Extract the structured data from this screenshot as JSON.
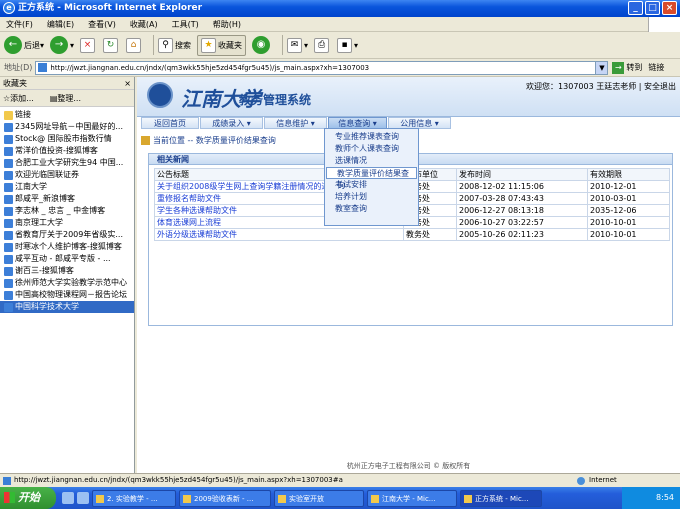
{
  "window": {
    "title": "正方系统 - Microsoft Internet Explorer"
  },
  "menu": [
    "文件(F)",
    "编辑(E)",
    "查看(V)",
    "收藏(A)",
    "工具(T)",
    "帮助(H)"
  ],
  "toolbar": {
    "back": "后退",
    "search": "搜索",
    "favorites": "收藏夹"
  },
  "address": {
    "label": "地址(D)",
    "url": "http://jwzt.jiangnan.edu.cn/jndx/(qm3wkk55hje5zd454fgr5u45)/js_main.aspx?xh=1307003",
    "go": "转到",
    "links": "链接"
  },
  "favorites": {
    "header": "收藏夹",
    "add": "添加...",
    "organize": "整理...",
    "items": [
      {
        "label": "链接",
        "folder": true
      },
      {
        "label": "2345网址导航－中国最好的..."
      },
      {
        "label": "Stock@ 国际股市指数行情"
      },
      {
        "label": "常洋价值投资-搜狐博客"
      },
      {
        "label": "合肥工业大学研究生94 中国..."
      },
      {
        "label": "欢迎光临国联证券"
      },
      {
        "label": "江南大学"
      },
      {
        "label": "郎咸平_新浪博客"
      },
      {
        "label": "李志林 _ 忠言 _ 中金博客"
      },
      {
        "label": "南京理工大学"
      },
      {
        "label": "省教育厅关于2009年省级实..."
      },
      {
        "label": "时寒冰个人维护博客-搜狐博客"
      },
      {
        "label": "咸平互动 - 郎咸平专版 - ..."
      },
      {
        "label": "谢百三-搜狐博客"
      },
      {
        "label": "徐州师范大学实验教学示范中心"
      },
      {
        "label": "中国高校物理课程网－报告论坛"
      },
      {
        "label": "中国科学技术大学",
        "selected": true
      }
    ]
  },
  "site": {
    "logo_text": "江南大学",
    "system_name": "教务管理系统",
    "welcome": "欢迎您：1307003 王廷志老师 | 安全退出",
    "nav": [
      {
        "label": "返回首页"
      },
      {
        "label": "成绩录入 ▾"
      },
      {
        "label": "信息维护 ▾"
      },
      {
        "label": "信息查询 ▾",
        "active": true
      },
      {
        "label": "公用信息 ▾"
      }
    ],
    "breadcrumb": "当前位置 -- 数学质量评价结果查询",
    "dropdown": [
      "专业推荐课表查询",
      "教师个人课表查询",
      "选课情况",
      "教学质量评价结果查询",
      "考试安排",
      "培养计划",
      "教室查询"
    ],
    "dropdown_highlight": 3,
    "panel_title": "相关新闻",
    "table": {
      "headers": [
        "公告标题",
        "发布单位",
        "发布时间",
        "有效期限"
      ],
      "rows": [
        [
          "关于组织2008级学生网上查询学籍注册情况的通知",
          "教务处",
          "2008-12-02 11:15:06",
          "2010-12-01"
        ],
        [
          "重修报名帮助文件",
          "教务处",
          "2007-03-28 07:43:43",
          "2010-03-01"
        ],
        [
          "学生各种选课帮助文件",
          "教务处",
          "2006-12-27 08:13:18",
          "2035-12-06"
        ],
        [
          "体育选课网上流程",
          "教务处",
          "2006-10-27 03:22:57",
          "2010-10-01"
        ],
        [
          "外语分级选课帮助文件",
          "教务处",
          "2005-10-26 02:11:23",
          "2010-10-01"
        ]
      ]
    },
    "footer": "杭州正方电子工程有限公司 © 版权所有"
  },
  "status": {
    "text": "http://jwzt.jiangnan.edu.cn/jndx/(qm3wkk55hje5zd454fgr5u45)/js_main.aspx?xh=1307003#a",
    "zone": "Internet"
  },
  "taskbar": {
    "start": "开始",
    "tasks": [
      "2. 实验教学 - ...",
      "2009验收表新 - ...",
      "实验室开放",
      "江南大学 - Mic...",
      "正方系统 - Mic..."
    ],
    "active": 4,
    "clock": "8:54"
  }
}
